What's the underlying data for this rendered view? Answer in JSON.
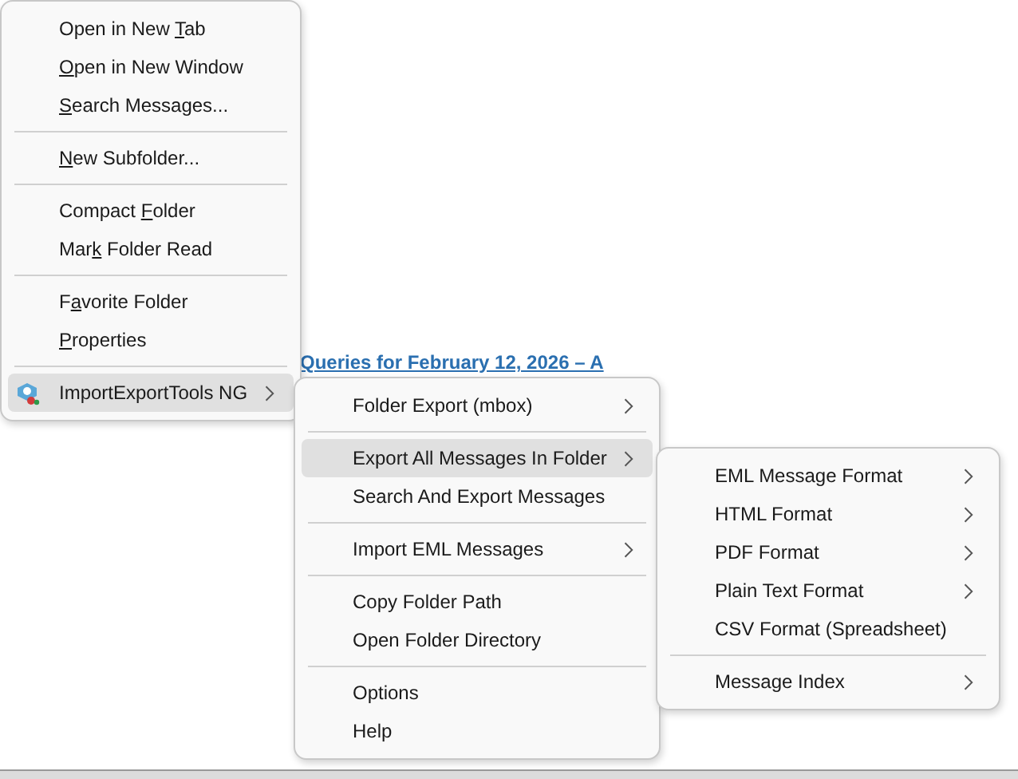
{
  "background": {
    "link": "Queries for February 12, 2026 – A"
  },
  "menus": [
    {
      "items": [
        {
          "kind": "item",
          "text_before": "Open in New ",
          "access_key": "T",
          "text_after": "ab",
          "submenu": false,
          "selected": false
        },
        {
          "kind": "item",
          "access_key": "O",
          "text_after": "pen in New Window",
          "submenu": false,
          "selected": false
        },
        {
          "kind": "item",
          "access_key": "S",
          "text_after": "earch Messages...",
          "submenu": false,
          "selected": false
        },
        {
          "kind": "separator"
        },
        {
          "kind": "item",
          "access_key": "N",
          "text_after": "ew Subfolder...",
          "submenu": false,
          "selected": false
        },
        {
          "kind": "separator"
        },
        {
          "kind": "item",
          "text_before": "Compact ",
          "access_key": "F",
          "text_after": "older",
          "submenu": false,
          "selected": false
        },
        {
          "kind": "item",
          "text_before": "Mar",
          "access_key": "k",
          "text_after": " Folder Read",
          "submenu": false,
          "selected": false
        },
        {
          "kind": "separator"
        },
        {
          "kind": "item",
          "text_before": "F",
          "access_key": "a",
          "text_after": "vorite Folder",
          "submenu": false,
          "selected": false
        },
        {
          "kind": "item",
          "access_key": "P",
          "text_after": "roperties",
          "submenu": false,
          "selected": false
        },
        {
          "kind": "separator"
        },
        {
          "kind": "item",
          "label": "ImportExportTools NG",
          "submenu": true,
          "selected": true,
          "icon": true
        }
      ]
    },
    {
      "items": [
        {
          "kind": "item",
          "label": "Folder Export (mbox)",
          "submenu": true,
          "selected": false
        },
        {
          "kind": "separator"
        },
        {
          "kind": "item",
          "label": "Export All Messages In Folder",
          "submenu": true,
          "selected": true
        },
        {
          "kind": "item",
          "label": "Search And Export Messages",
          "submenu": false,
          "selected": false
        },
        {
          "kind": "separator"
        },
        {
          "kind": "item",
          "label": "Import EML Messages",
          "submenu": true,
          "selected": false
        },
        {
          "kind": "separator"
        },
        {
          "kind": "item",
          "label": "Copy Folder Path",
          "submenu": false,
          "selected": false
        },
        {
          "kind": "item",
          "label": "Open Folder Directory",
          "submenu": false,
          "selected": false
        },
        {
          "kind": "separator"
        },
        {
          "kind": "item",
          "label": "Options",
          "submenu": false,
          "selected": false
        },
        {
          "kind": "item",
          "label": "Help",
          "submenu": false,
          "selected": false
        }
      ]
    },
    {
      "items": [
        {
          "kind": "item",
          "label": "EML Message Format",
          "submenu": true,
          "selected": false
        },
        {
          "kind": "item",
          "label": "HTML Format",
          "submenu": true,
          "selected": false
        },
        {
          "kind": "item",
          "label": "PDF Format",
          "submenu": true,
          "selected": false
        },
        {
          "kind": "item",
          "label": "Plain Text Format",
          "submenu": true,
          "selected": false
        },
        {
          "kind": "item",
          "label": "CSV Format (Spreadsheet)",
          "submenu": false,
          "selected": false
        },
        {
          "kind": "separator"
        },
        {
          "kind": "item",
          "label": "Message Index",
          "submenu": true,
          "selected": false
        }
      ]
    }
  ]
}
